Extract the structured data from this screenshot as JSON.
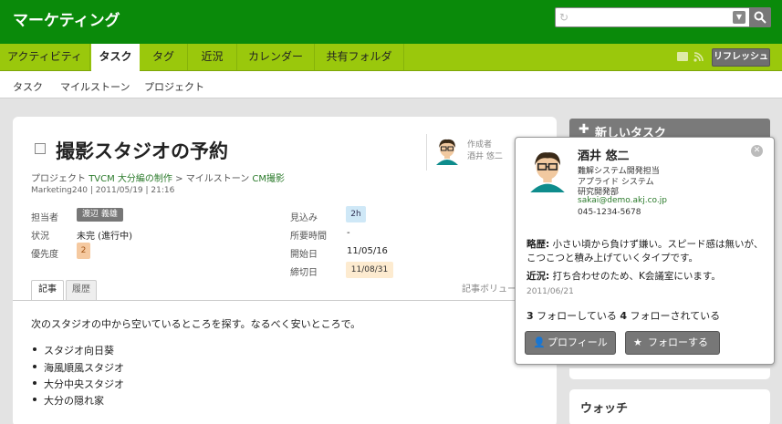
{
  "app": {
    "title": "マーケティング"
  },
  "tabs": [
    "アクティビティ",
    "タスク",
    "タグ",
    "近況",
    "カレンダー",
    "共有フォルダ"
  ],
  "refresh_label": "リフレッシュ",
  "subnav": [
    "タスク",
    "マイルストーン",
    "プロジェクト"
  ],
  "task": {
    "title": "撮影スタジオの予約",
    "crumb_project_prefix": "プロジェクト",
    "crumb_project": "TVCM 大分編の制作",
    "crumb_sep": ">",
    "crumb_milestone_prefix": "マイルストーン",
    "crumb_milestone": "CM撮影",
    "meta": "Marketing240 | 2011/05/19 | 21:16",
    "creator_label": "作成者",
    "creator_name": "酒井 悠二",
    "fields": {
      "owner_label": "担当者",
      "owner": "渡辺 義雄",
      "status_label": "状況",
      "status": "未完 (進行中)",
      "priority_label": "優先度",
      "priority": "2",
      "estimate_label": "見込み",
      "estimate": "2h",
      "spent_label": "所要時間",
      "spent": "-",
      "start_label": "開始日",
      "start": "11/05/16",
      "due_label": "締切日",
      "due": "11/08/31"
    },
    "content_tabs": [
      "記事",
      "履歴"
    ],
    "article_vol": "記事ボリュー",
    "body": "次のスタジオの中から空いているところを探す。なるべく安いところで。",
    "bullets": [
      "スタジオ向日葵",
      "海風順風スタジオ",
      "大分中央スタジオ",
      "大分の隠れ家"
    ]
  },
  "sidebar": {
    "new_task": "新しいタスク",
    "watch": "ウォッチ"
  },
  "popup": {
    "name": "酒井 悠二",
    "role": "難解システム開発担当",
    "company": "アプライド システム",
    "dept": "研究開発部",
    "email": "sakai@demo.akj.co.jp",
    "phone": "045-1234-5678",
    "bio_label": "略歴:",
    "bio": "小さい頃から負けず嫌い。スピード感は無いが、こつこつと積み上げていくタイプです。",
    "status_label": "近況:",
    "status": "打ち合わせのため、K会議室にいます。",
    "status_date": "2011/06/21",
    "following_count": "3",
    "following_text": "フォローしている",
    "followers_count": "4",
    "followers_text": "フォローされている",
    "profile_btn": "プロフィール",
    "follow_btn": "フォローする"
  }
}
